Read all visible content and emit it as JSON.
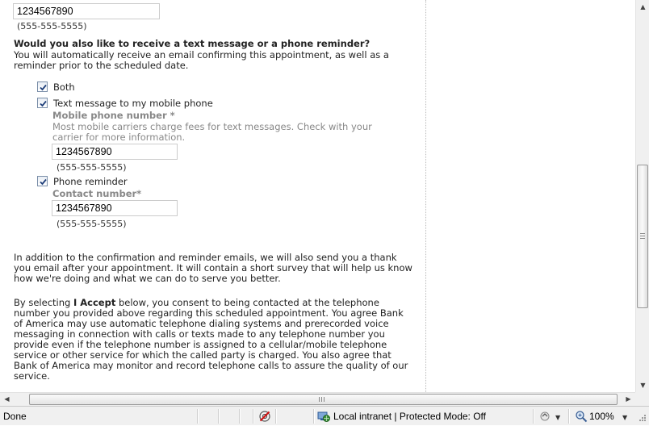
{
  "form": {
    "top_phone_value": "1234567890",
    "top_phone_hint": "(555-555-5555)",
    "reminder_heading": "Would you also like to receive a text message or a phone reminder?",
    "reminder_desc_1": "You will automatically receive an email confirming this appointment, as well as a",
    "reminder_desc_2": "reminder prior to the scheduled date.",
    "options": {
      "both": {
        "label": "Both",
        "checked": true
      },
      "text": {
        "label": "Text message to my mobile phone",
        "checked": true
      },
      "phone": {
        "label": "Phone reminder",
        "checked": true
      }
    },
    "mobile_label": "Mobile phone number *",
    "mobile_note_1": "Most mobile carriers charge fees for text messages. Check with your",
    "mobile_note_2": "carrier for more information.",
    "mobile_value": "1234567890",
    "mobile_hint": "(555-555-5555)",
    "contact_label": "Contact number*",
    "contact_value": "1234567890",
    "contact_hint": "(555-555-5555)",
    "thanks_1": "In addition to the confirmation and reminder emails, we will also send you a thank",
    "thanks_2": "you email after your appointment. It will contain a short survey that will help us know",
    "thanks_3": "how we're doing and what we can do to serve you better.",
    "consent_prefix": "By selecting ",
    "consent_accept": "I Accept",
    "consent_1_rest": " below, you consent to being contacted at the telephone",
    "consent_2": "number you provided above regarding this scheduled appointment. You agree Bank",
    "consent_3": "of America may use automatic telephone dialing systems and prerecorded voice",
    "consent_4": "messaging in connection with calls or texts made to any telephone number you",
    "consent_5": "provide even if the telephone number is assigned to a cellular/mobile telephone",
    "consent_6": "service or other service for which the called party is charged. You also agree that",
    "consent_7": "Bank of America may monitor and record telephone calls to assure the quality of our",
    "consent_8": "service."
  },
  "statusbar": {
    "status": "Done",
    "zone": "Local intranet | Protected Mode: Off",
    "zoom": "100%"
  },
  "icons": {
    "privacy": "privacy-icon",
    "zone": "intranet-globe-icon",
    "security": "security-icon",
    "zoom": "magnifier-icon"
  }
}
